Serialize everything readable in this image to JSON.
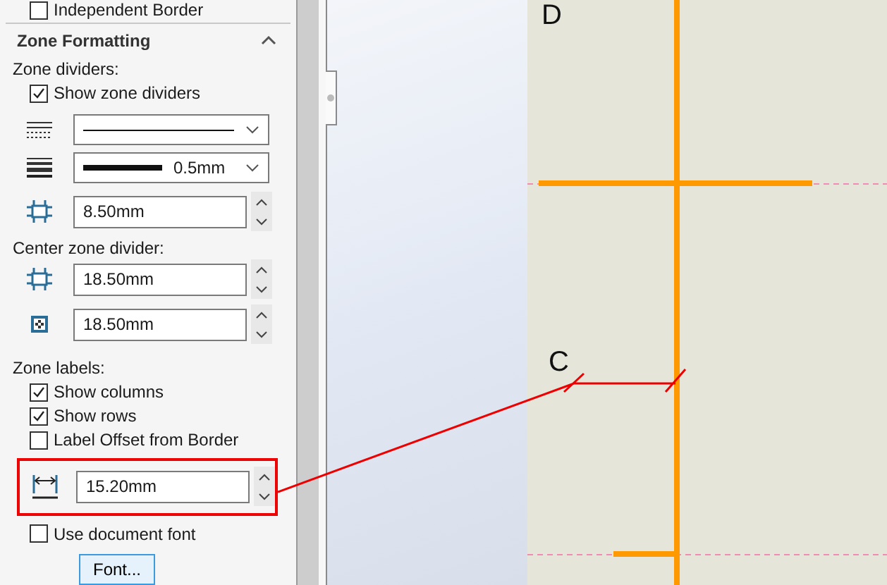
{
  "top_option": {
    "label": "Independent Border",
    "checked": false
  },
  "section": {
    "title": "Zone Formatting",
    "expanded": true
  },
  "zone_dividers": {
    "heading": "Zone dividers:",
    "show": {
      "label": "Show zone dividers",
      "checked": true
    },
    "thickness": {
      "value": "0.5mm"
    },
    "size": {
      "value": "8.50mm"
    }
  },
  "center_zone_divider": {
    "heading": "Center zone divider:",
    "fields": [
      {
        "kind": "width",
        "value": "18.50mm"
      },
      {
        "kind": "height",
        "value": "18.50mm"
      }
    ]
  },
  "zone_labels": {
    "heading": "Zone labels:",
    "options": [
      {
        "label": "Show columns",
        "checked": true
      },
      {
        "label": "Show rows",
        "checked": true
      },
      {
        "label": "Label Offset from Border",
        "checked": false
      }
    ],
    "offset": {
      "value": "15.20mm",
      "highlighted": true
    }
  },
  "use_document_font": {
    "label": "Use document font",
    "checked": false
  },
  "font_button": "Font...",
  "sheet": {
    "zone_letters": [
      {
        "text": "D"
      },
      {
        "text": "C"
      }
    ]
  }
}
